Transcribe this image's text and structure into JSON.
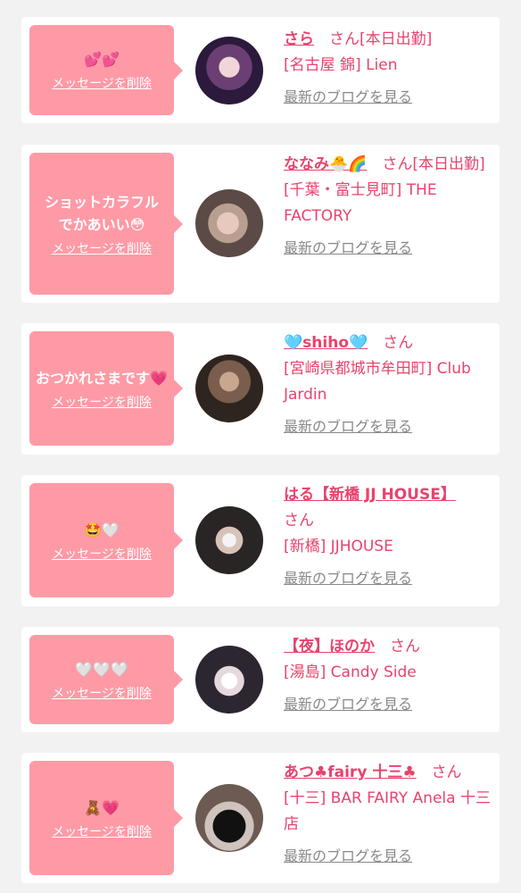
{
  "delete_label": "メッセージを削除",
  "blog_label": "最新のブログを見る",
  "cards": [
    {
      "message": "💕💕",
      "name": "さら",
      "suffix": "　さん[本日出勤]",
      "shop": "[名古屋 錦] Lien"
    },
    {
      "message": "ショットカラフルでかあいい😳",
      "name": "ななみ🐣🌈",
      "suffix": "　さん[本日出勤]",
      "shop": "[千葉・富士見町] THE FACTORY"
    },
    {
      "message": "おつかれさまです💗",
      "name": "🩵shiho🩵",
      "suffix": "　さん",
      "shop": "[宮崎県都城市牟田町] Club Jardin"
    },
    {
      "message": "🤩🤍",
      "name": "はる【新橋 JJ HOUSE】",
      "suffix": " さん",
      "shop": "[新橋] JJHOUSE"
    },
    {
      "message": "🤍🤍🤍",
      "name": "【夜】ほのか",
      "suffix": "　さん",
      "shop": "[湯島] Candy Side"
    },
    {
      "message": "🧸💗",
      "name": "あつ♣fairy 十三♣",
      "suffix": "　さん",
      "shop": "[十三] BAR FAIRY Anela 十三店"
    }
  ]
}
